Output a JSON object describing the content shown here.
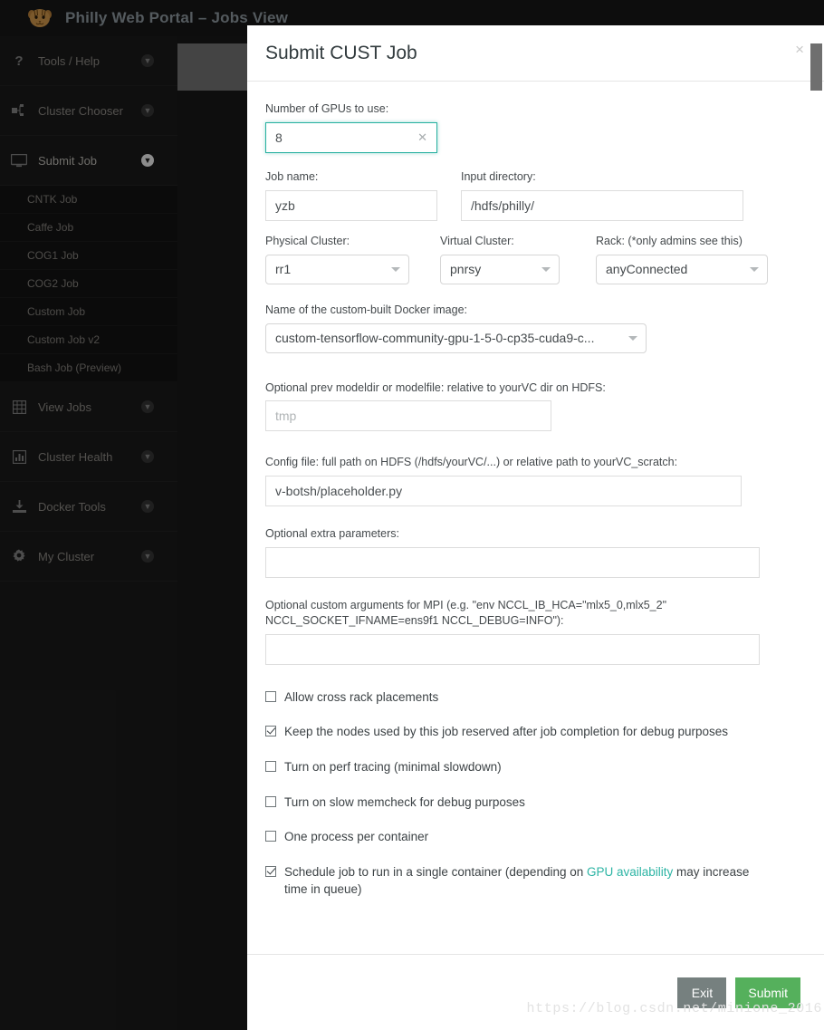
{
  "app": {
    "logo_icon": "tiger-face-icon",
    "title": "Philly Web Portal – Jobs View"
  },
  "sidebar": {
    "items": [
      {
        "label": "Tools / Help",
        "icon": "question-mark-icon",
        "caret": "chevron-down-icon",
        "active": false
      },
      {
        "label": "Cluster Chooser",
        "icon": "cluster-nodes-icon",
        "caret": "chevron-down-icon",
        "active": false
      },
      {
        "label": "Submit Job",
        "icon": "monitor-icon",
        "caret": "chevron-down-icon",
        "active": true
      },
      {
        "label": "View Jobs",
        "icon": "table-grid-icon",
        "caret": "chevron-down-icon",
        "active": false
      },
      {
        "label": "Cluster Health",
        "icon": "bar-chart-icon",
        "caret": "chevron-down-icon",
        "active": false
      },
      {
        "label": "Docker Tools",
        "icon": "download-icon",
        "caret": "chevron-down-icon",
        "active": false
      },
      {
        "label": "My Cluster",
        "icon": "gear-icon",
        "caret": "chevron-down-icon",
        "active": false
      }
    ],
    "submenu": [
      "CNTK Job",
      "Caffe Job",
      "COG1 Job",
      "COG2 Job",
      "Custom Job",
      "Custom Job v2",
      "Bash Job (Preview)"
    ]
  },
  "modal": {
    "title": "Submit CUST Job",
    "close_label": "×",
    "fields": {
      "gpus": {
        "label": "Number of GPUs to use:",
        "value": "8",
        "clear_label": "✕",
        "focus_color": "#27b0a0"
      },
      "job_name": {
        "label": "Job name:",
        "value": "yzb"
      },
      "input_dir": {
        "label": "Input directory:",
        "value": "/hdfs/philly/"
      },
      "physical_cluster": {
        "label": "Physical Cluster:",
        "value": "rr1"
      },
      "virtual_cluster": {
        "label": "Virtual Cluster:",
        "value": "pnrsy"
      },
      "rack": {
        "label": "Rack: (*only admins see this)",
        "value": "anyConnected"
      },
      "docker_image": {
        "label": "Name of the custom-built Docker image:",
        "value": "custom-tensorflow-community-gpu-1-5-0-cp35-cuda9-c..."
      },
      "prev_modeldir": {
        "label": "Optional prev modeldir or modelfile: relative to yourVC dir on HDFS:",
        "value": "",
        "placeholder": "tmp"
      },
      "config_file": {
        "label": "Config file: full path on HDFS (/hdfs/yourVC/...) or relative path to yourVC_scratch:",
        "value": "v-botsh/placeholder.py"
      },
      "extra_params": {
        "label": "Optional extra parameters:",
        "value": ""
      },
      "mpi_args": {
        "label": "Optional custom arguments for MPI (e.g. \"env NCCL_IB_HCA=\"mlx5_0,mlx5_2\" NCCL_SOCKET_IFNAME=ens9f1 NCCL_DEBUG=INFO\"):",
        "value": ""
      }
    },
    "checkboxes": [
      {
        "label": "Allow cross rack placements",
        "checked": false
      },
      {
        "label": "Keep the nodes used by this job reserved after job completion for debug purposes",
        "checked": true
      },
      {
        "label": "Turn on perf tracing (minimal slowdown)",
        "checked": false
      },
      {
        "label": "Turn on slow memcheck for debug purposes",
        "checked": false
      },
      {
        "label": "One process per container",
        "checked": false
      }
    ],
    "single_container": {
      "checked": true,
      "text_before": "Schedule job to run in a single container (depending on ",
      "link_text": "GPU availability",
      "text_after": " may increase time in queue)",
      "link_color": "#2cb4a4"
    },
    "footer": {
      "exit_label": "Exit",
      "submit_label": "Submit",
      "exit_color": "#76807f",
      "submit_color": "#55b05c"
    }
  },
  "watermark": "https://blog.csdn.net/minione_2016"
}
